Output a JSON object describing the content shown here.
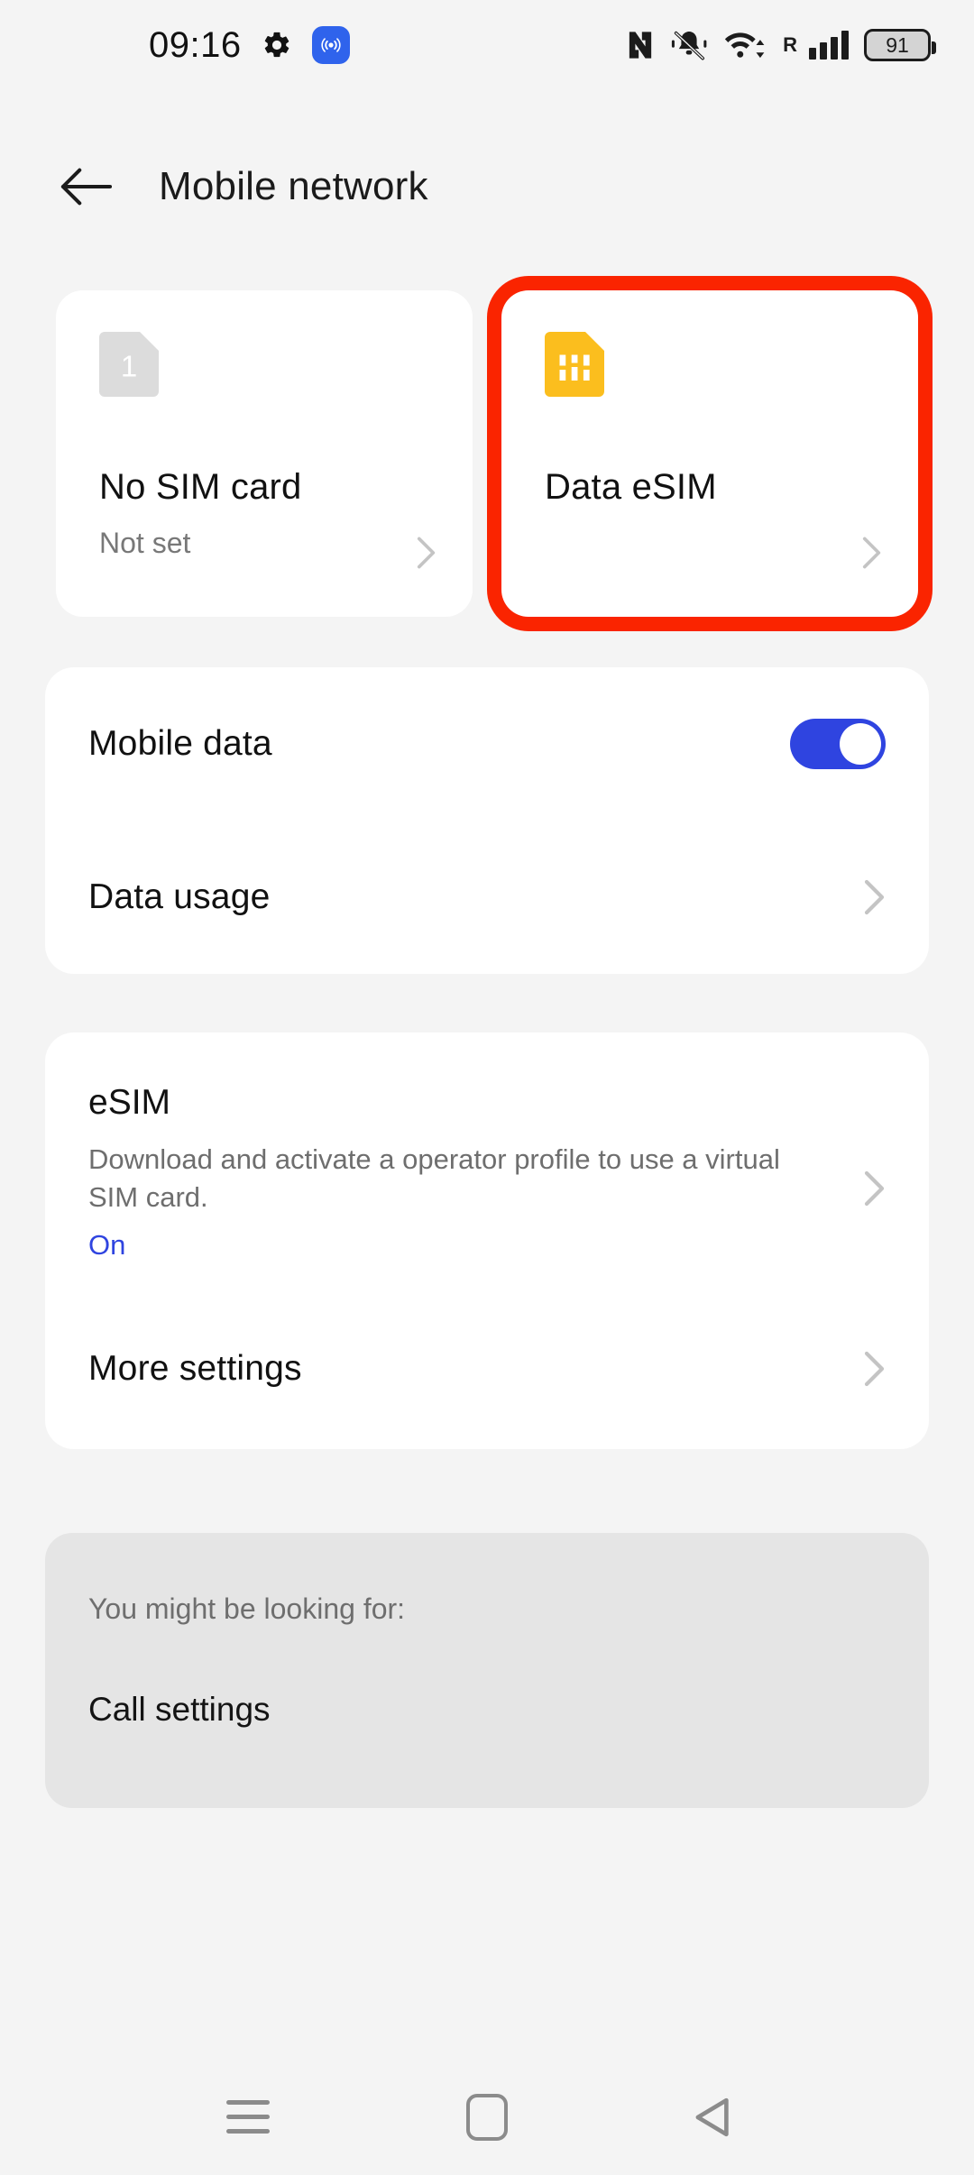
{
  "status_bar": {
    "time": "09:16",
    "icons": {
      "settings": "gear-icon",
      "broadcast_badge": "broadcast-icon",
      "nfc": "nfc-icon",
      "ringer_muted": "bell-muted-icon",
      "wifi": "wifi-icon",
      "roaming_letter": "R",
      "signal": "signal-bars-icon"
    },
    "battery_percent": "91",
    "accent_badge_color": "#2F63EC"
  },
  "header": {
    "back_label": "back-arrow",
    "title": "Mobile network"
  },
  "sim_cards": [
    {
      "icon": "sim-card-icon",
      "icon_color": "#DCDCDC",
      "badge_number": "1",
      "name": "No SIM card",
      "subtitle": "Not set",
      "highlighted": false
    },
    {
      "icon": "esim-card-icon",
      "icon_color": "#FBBE1E",
      "badge_number": "",
      "name": "Data eSIM",
      "subtitle": "",
      "highlighted": true
    }
  ],
  "highlight_color": "#FA2400",
  "data_card": {
    "mobile_data": {
      "label": "Mobile data",
      "toggle_on": true,
      "toggle_color": "#2F44E0"
    },
    "data_usage": {
      "label": "Data usage"
    }
  },
  "esim_card": {
    "title": "eSIM",
    "description": "Download and activate a operator profile to use a virtual SIM card.",
    "state": "On",
    "state_color": "#2F44E0",
    "more_settings": "More settings"
  },
  "suggestions": {
    "label": "You might be looking for:",
    "items": [
      {
        "label": "Call settings"
      }
    ]
  },
  "nav_bar": {
    "recents": "recents-icon",
    "home": "home-icon",
    "back": "back-triangle-icon"
  }
}
